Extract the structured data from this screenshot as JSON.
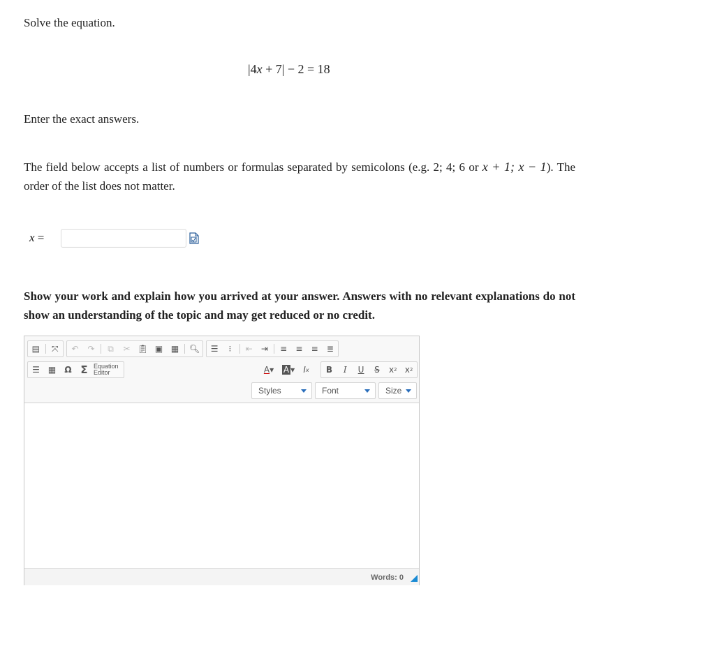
{
  "question": {
    "prompt": "Solve the equation.",
    "equation": "|4x + 7| − 2 = 18",
    "enter_exact": "Enter the exact answers.",
    "instructions_line1": "The field below accepts a list of numbers or formulas separated by semicolons (e.g. 2; 4; 6 or",
    "instructions_line2_math": "x + 1; x − 1",
    "instructions_line2_text": "). The order of the list does not matter.",
    "answer_label": "x =",
    "answer_value": "",
    "show_work": "Show your work and explain how you arrived at your answer. Answers with no relevant explanations do not show an understanding of the topic and may get reduced or no credit."
  },
  "editor": {
    "toolbar_row1": [
      "source-icon",
      "maximize-icon",
      "undo-icon",
      "redo-icon",
      "copy-icon",
      "cut-icon",
      "paste-icon",
      "paste-text-icon",
      "paste-word-icon",
      "find-icon",
      "numbered-list-icon",
      "bulleted-list-icon",
      "outdent-icon",
      "indent-icon",
      "align-left-icon",
      "align-center-icon",
      "align-right-icon",
      "justify-icon"
    ],
    "equation_label_1": "Equation",
    "equation_label_2": "Editor",
    "styles_label": "Styles",
    "font_label": "Font",
    "size_label": "Size",
    "bold": "B",
    "italic": "I",
    "underline": "U",
    "strike": "S",
    "words_count": "Words: 0",
    "accent_color": "#1a8ad4"
  }
}
